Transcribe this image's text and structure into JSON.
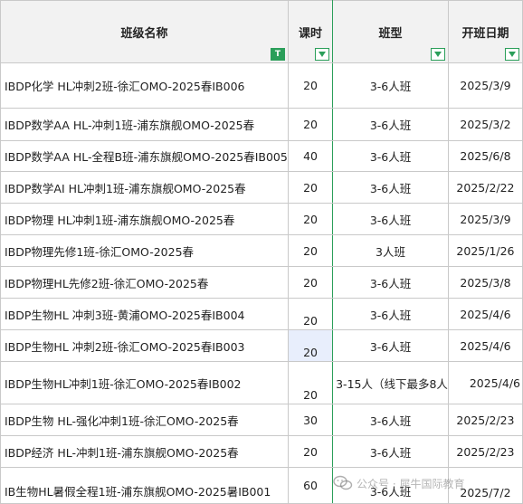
{
  "headers": {
    "name": "班级名称",
    "hours": "课时",
    "type": "班型",
    "date": "开班日期"
  },
  "filter_active_glyph": "T",
  "rows": [
    {
      "name": "IBDP化学 HL冲刺2班-徐汇OMO-2025春IB006",
      "hours": "20",
      "type": "3-6人班",
      "date": "2025/3/9"
    },
    {
      "name": "IBDP数学AA HL-冲刺1班-浦东旗舰OMO-2025春",
      "hours": "20",
      "type": "3-6人班",
      "date": "2025/3/2"
    },
    {
      "name": "IBDP数学AA HL-全程B班-浦东旗舰OMO-2025春IB005",
      "hours": "40",
      "type": "3-6人班",
      "date": "2025/6/8"
    },
    {
      "name": "IBDP数学AI HL冲刺1班-浦东旗舰OMO-2025春",
      "hours": "20",
      "type": "3-6人班",
      "date": "2025/2/22"
    },
    {
      "name": "IBDP物理 HL冲刺1班-浦东旗舰OMO-2025春",
      "hours": "20",
      "type": "3-6人班",
      "date": "2025/3/9"
    },
    {
      "name": "IBDP物理先修1班-徐汇OMO-2025春",
      "hours": "20",
      "type": "3人班",
      "date": "2025/1/26"
    },
    {
      "name": "IBDP物理HL先修2班-徐汇OMO-2025春",
      "hours": "20",
      "type": "3-6人班",
      "date": "2025/3/8"
    },
    {
      "name": "IBDP生物HL 冲刺3班-黄浦OMO-2025春IB004",
      "hours": "20",
      "type": "3-6人班",
      "date": "2025/4/6"
    },
    {
      "name": "IBDP生物HL 冲刺2班-徐汇OMO-2025春IB003",
      "hours": "20",
      "type": "3-6人班",
      "date": "2025/4/6"
    },
    {
      "name": "IBDP生物HL冲刺1班-徐汇OMO-2025春IB002",
      "hours": "20",
      "type": "3-15人（线下最多8人",
      "date": "2025/4/6"
    },
    {
      "name": "IBDP生物 HL-强化冲刺1班-徐汇OMO-2025春",
      "hours": "30",
      "type": "3-6人班",
      "date": "2025/2/23"
    },
    {
      "name": "IBDP经济 HL-冲刺1班-浦东旗舰OMO-2025春",
      "hours": "20",
      "type": "3-6人班",
      "date": "2025/2/23"
    },
    {
      "name": "IB生物HL暑假全程1班-浦东旗舰OMO-2025暑IB001",
      "hours": "60",
      "type": "3-6人班",
      "date": "2025/7/2"
    }
  ],
  "watermark": {
    "icon": "wechat-icon",
    "text": "公众号 · 犀牛国际教育"
  }
}
